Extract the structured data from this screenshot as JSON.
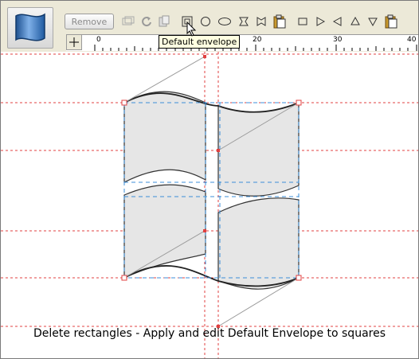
{
  "toolbar": {
    "remove_label": "Remove",
    "icons": [
      "copy-envelope-icon",
      "rotate-icon",
      "paste-icon",
      "rectangle-envelope-icon",
      "circle-envelope-icon",
      "ellipse-envelope-icon",
      "hourglass-envelope-icon",
      "bowtie-envelope-icon",
      "clipboard-icon",
      "square-icon",
      "play-icon",
      "triangle-left-icon",
      "triangle-up-icon",
      "triangle-down-icon",
      "clipboard-paste-icon"
    ]
  },
  "ruler": {
    "labels": [
      "0",
      "10",
      "20",
      "30",
      "40"
    ]
  },
  "tooltip": {
    "text": "Default envelope"
  },
  "caption": {
    "text": "Delete rectangles - Apply and edit Default Envelope to squares"
  },
  "colors": {
    "guide": "#e04040",
    "handle": "#e04040",
    "dashed": "#3c8fd8",
    "shape_fill": "#e6e6e6"
  }
}
